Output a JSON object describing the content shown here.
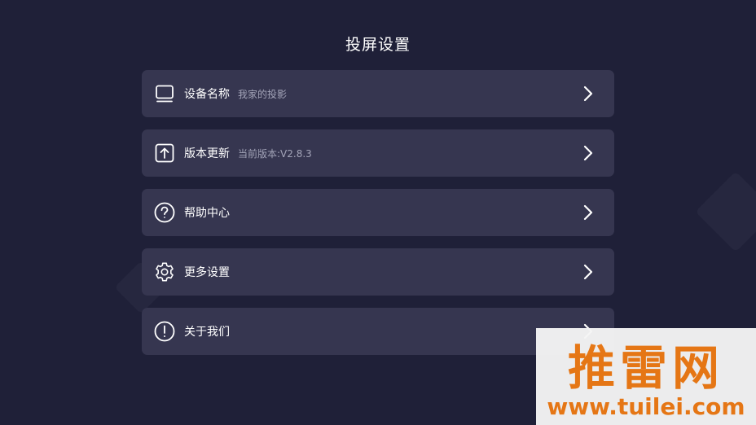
{
  "header": {
    "title": "投屏设置"
  },
  "menu": {
    "items": [
      {
        "icon": "monitor-icon",
        "label": "设备名称",
        "sub": "我家的投影"
      },
      {
        "icon": "upload-icon",
        "label": "版本更新",
        "sub": "当前版本:V2.8.3"
      },
      {
        "icon": "help-icon",
        "label": "帮助中心",
        "sub": ""
      },
      {
        "icon": "gear-icon",
        "label": "更多设置",
        "sub": ""
      },
      {
        "icon": "info-icon",
        "label": "关于我们",
        "sub": ""
      }
    ]
  },
  "watermark": {
    "title": "推雷网",
    "url": "www.tuilei.com"
  },
  "colors": {
    "background": "#1f2038",
    "card": "#363650",
    "text": "#ffffff",
    "subtext": "#a3a4b8",
    "watermark": "#ee7a14"
  }
}
